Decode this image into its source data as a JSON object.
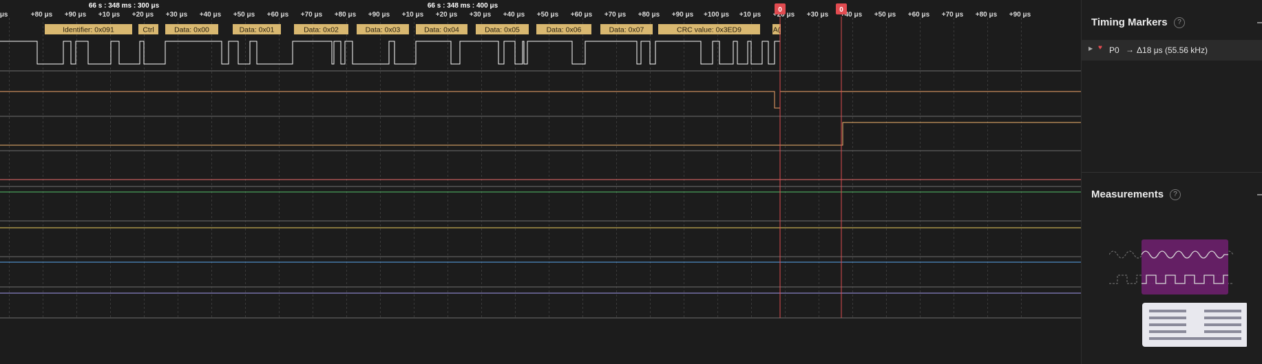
{
  "timeline": {
    "group_labels": [
      {
        "text": "66 s : 348 ms : 300 μs"
      },
      {
        "text": "66 s : 348 ms : 400 μs"
      }
    ],
    "ticks": [
      {
        "label": "μs"
      },
      {
        "label": "+80 μs"
      },
      {
        "label": "+90 μs"
      },
      {
        "label": "+10 μs"
      },
      {
        "label": "+20 μs"
      },
      {
        "label": "+30 μs"
      },
      {
        "label": "+40 μs"
      },
      {
        "label": "+50 μs"
      },
      {
        "label": "+60 μs"
      },
      {
        "label": "+70 μs"
      },
      {
        "label": "+80 μs"
      },
      {
        "label": "+90 μs"
      },
      {
        "label": "+10 μs"
      },
      {
        "label": "+20 μs"
      },
      {
        "label": "+30 μs"
      },
      {
        "label": "+40 μs"
      },
      {
        "label": "+50 μs"
      },
      {
        "label": "+60 μs"
      },
      {
        "label": "+70 μs"
      },
      {
        "label": "+80 μs"
      },
      {
        "label": "+90 μs"
      },
      {
        "label": "+100 μs"
      },
      {
        "label": "+10 μs"
      },
      {
        "label": "+20 μs"
      },
      {
        "label": "+30 μs"
      },
      {
        "label": "+40 μs"
      },
      {
        "label": "+50 μs"
      },
      {
        "label": "+60 μs"
      },
      {
        "label": "+70 μs"
      },
      {
        "label": "+80 μs"
      },
      {
        "label": "+90 μs"
      }
    ],
    "markers": [
      {
        "label": "0"
      },
      {
        "label": "0"
      }
    ]
  },
  "can_frames": [
    {
      "text": "Identifier: 0x091"
    },
    {
      "text": "Ctrl"
    },
    {
      "text": "Data: 0x00"
    },
    {
      "text": "Data: 0x01"
    },
    {
      "text": "Data: 0x02"
    },
    {
      "text": "Data: 0x03"
    },
    {
      "text": "Data: 0x04"
    },
    {
      "text": "Data: 0x05"
    },
    {
      "text": "Data: 0x06"
    },
    {
      "text": "Data: 0x07"
    },
    {
      "text": "CRC value: 0x3ED9"
    },
    {
      "text": "A("
    }
  ],
  "colors": {
    "background": "#1c1c1c",
    "frame_box": "#d9b870",
    "marker": "#e14b50",
    "channel_0": "#ffffff",
    "channel_1": "#f0a46a",
    "channel_2": "#f2b46e",
    "channel_3": "#f06e6e",
    "channel_4": "#55c26a",
    "channel_5": "#f0d060",
    "channel_6": "#5aa8f0",
    "channel_7": "#a49af0"
  },
  "sidebar": {
    "timing_markers": {
      "title": "Timing Markers",
      "help": "?",
      "row": {
        "name": "P0",
        "arrow": "→",
        "delta": "Δ18 μs (55.56 kHz)"
      }
    },
    "measurements": {
      "title": "Measurements",
      "help": "?"
    }
  }
}
